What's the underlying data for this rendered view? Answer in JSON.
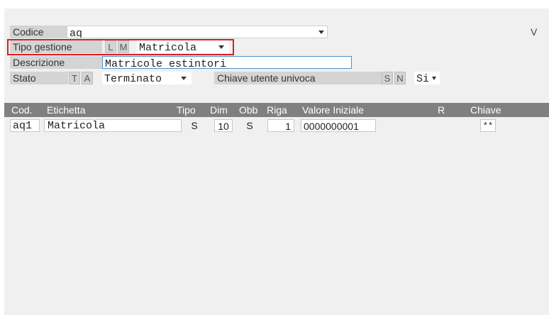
{
  "form": {
    "codice_label": "Codice",
    "codice_value": "aq",
    "version_mark": "V",
    "tipo_gestione_label": "Tipo gestione",
    "tipo_toggle_l": "L",
    "tipo_toggle_m": "M",
    "tipo_value": "Matricola",
    "descrizione_label": "Descrizione",
    "descrizione_value": "Matricole estintori",
    "stato_label": "Stato",
    "stato_toggle_t": "T",
    "stato_toggle_a": "A",
    "stato_value": "Terminato",
    "chiave_label": "Chiave utente univoca",
    "chiave_toggle_s": "S",
    "chiave_toggle_n": "N",
    "chiave_value": "Si"
  },
  "table": {
    "headers": [
      "Cod.",
      "Etichetta",
      "Tipo",
      "Dim",
      "Obb",
      "Riga",
      "Valore Iniziale",
      "R",
      "Chiave"
    ],
    "rows": [
      [
        "aq1",
        "Matricola",
        "S",
        "10",
        "S",
        "1",
        "0000000001",
        "",
        "**"
      ]
    ]
  },
  "colors": {
    "highlight_border": "#d62020",
    "header_bg": "#808080",
    "panel_bg": "#f0f0f0",
    "focus_border": "#4a90c8"
  }
}
